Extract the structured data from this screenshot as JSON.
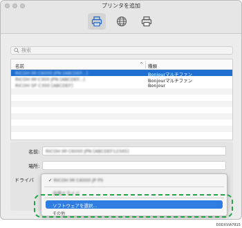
{
  "window": {
    "title": "プリンタを追加"
  },
  "toolbar": {
    "tabs": [
      {
        "name": "default-printer",
        "icon": "printer-icon",
        "active": true
      },
      {
        "name": "ip-printer",
        "icon": "globe-icon",
        "active": false
      },
      {
        "name": "windows-printer",
        "icon": "printer-windows-icon",
        "active": false
      }
    ]
  },
  "search": {
    "placeholder": "検索"
  },
  "table": {
    "columns": {
      "name": "名前",
      "kind": "種類"
    },
    "rows": [
      {
        "name": "RICOH IM C6000 JPN [ABCDEF...]",
        "kind": "Bonjourマルチファン",
        "selected": true
      },
      {
        "name": "RICOH IM C300 JPN [ABCDEF...]",
        "kind": "Bonjourマルチファン",
        "selected": false
      },
      {
        "name": "RICOH SP C300 [ABCDEF]",
        "kind": "Bonjour",
        "selected": false
      }
    ]
  },
  "form": {
    "name_label": "名前:",
    "name_value": "RICOH IM C6000 JPN [ABCDEF12345]",
    "location_label": "場所:",
    "location_value": "",
    "driver_label": "ドライバ"
  },
  "dropdown": {
    "checked_item": "RICOH IM C6000 JP PS",
    "other_item": "汎用ドライバ",
    "select_software": "ソフトウェアを選択..."
  },
  "footer": {
    "partial": "その他",
    "doc_id": "D0DXVIA7815"
  },
  "colors": {
    "selection": "#1f6fd1",
    "highlight": "#27a347"
  }
}
